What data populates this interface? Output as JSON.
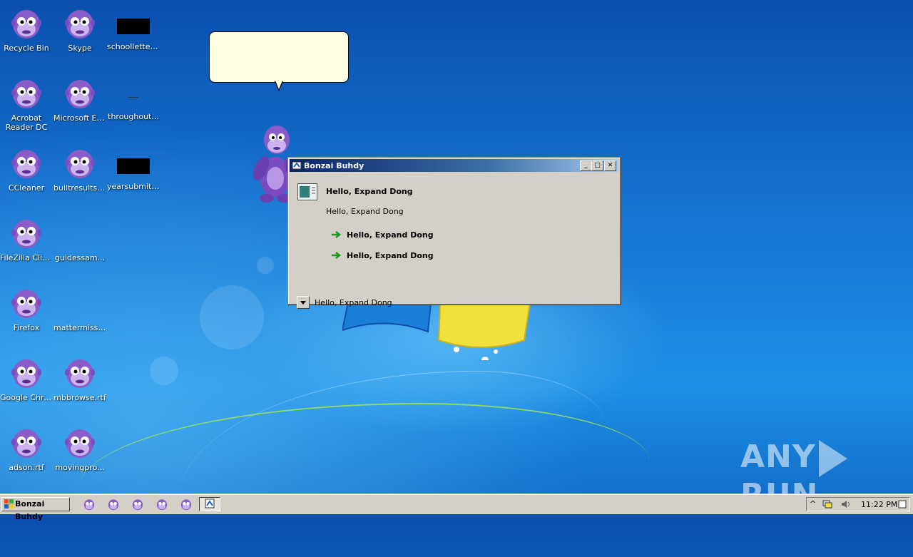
{
  "desktop": {
    "icons": [
      {
        "label": "Recycle Bin",
        "kind": "bonzi"
      },
      {
        "label": "Skype",
        "kind": "bonzi"
      },
      {
        "label": "schoolletter...",
        "kind": "black-box"
      },
      {
        "label": "Acrobat Reader DC",
        "kind": "bonzi"
      },
      {
        "label": "Microsoft Edge",
        "kind": "bonzi"
      },
      {
        "label": "throughout...",
        "kind": "dash"
      },
      {
        "label": "CCleaner",
        "kind": "bonzi"
      },
      {
        "label": "builtresults.rtf",
        "kind": "bonzi"
      },
      {
        "label": "yearsubmitt...",
        "kind": "black-box"
      },
      {
        "label": "FileZilla Client",
        "kind": "bonzi"
      },
      {
        "label": "guidessam...",
        "kind": "none"
      },
      {
        "label": "Firefox",
        "kind": "bonzi"
      },
      {
        "label": "mattermissi...",
        "kind": "none"
      },
      {
        "label": "Google Chrome",
        "kind": "bonzi"
      },
      {
        "label": "mbbrowse.rtf",
        "kind": "bonzi"
      },
      {
        "label": "adson.rtf",
        "kind": "bonzi"
      },
      {
        "label": "movingpro...",
        "kind": "bonzi"
      }
    ]
  },
  "dialog": {
    "title": "Bonzai Buhdy",
    "heading": "Hello, Expand Dong",
    "subtext": "Hello, Expand Dong",
    "options": [
      "Hello, Expand Dong",
      "Hello, Expand Dong"
    ],
    "expand_label": "Hello, Expand Dong",
    "buttons": {
      "minimize": "_",
      "maximize": "□",
      "close": "✕"
    }
  },
  "taskbar": {
    "start_label": "Bonzai Buhdy",
    "clock": "11:22 PM",
    "tray_chevron": "^"
  },
  "watermark": {
    "left": "ANY",
    "right": "RUN"
  },
  "colors": {
    "dialog_bg": "#d4d0c8",
    "titlebar_start": "#0a246a",
    "bubble_bg": "#ffffe1",
    "arrow_green": "#1a9a1a",
    "ape_purple": "#8a5cc8"
  }
}
